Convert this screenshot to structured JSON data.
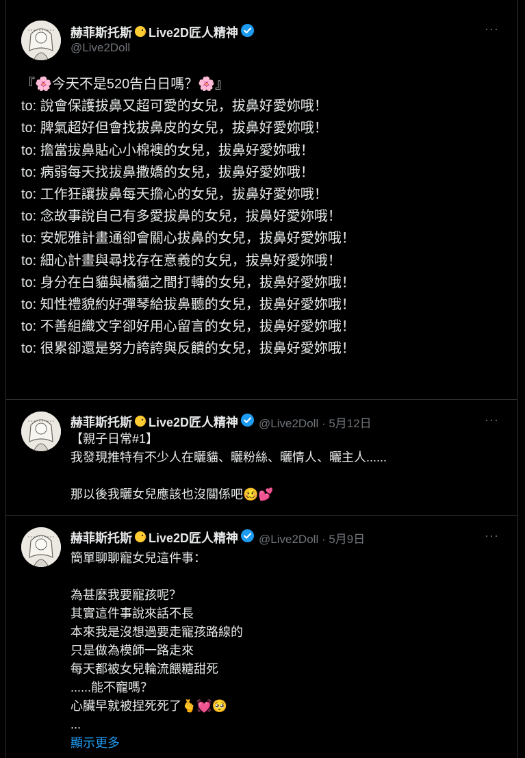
{
  "main_tweet": {
    "display_name": "赫菲斯托斯",
    "display_name_suffix": "Live2D匠人精神",
    "handle": "@Live2Doll",
    "lines": [
      "『🌸今天不是520告白日嗎？🌸』",
      "",
      "to: 說會保護拔鼻又超可愛的女兒，拔鼻好愛妳哦！",
      "to: 脾氣超好但會找拔鼻皮的女兒，拔鼻好愛妳哦！",
      "to: 擔當拔鼻貼心小棉襖的女兒，拔鼻好愛妳哦！",
      "to: 病弱每天找拔鼻撒嬌的女兒，拔鼻好愛妳哦！",
      "to: 工作狂讓拔鼻每天擔心的女兒，拔鼻好愛妳哦！",
      "to: 念故事說自己有多愛拔鼻的女兒，拔鼻好愛妳哦！",
      "to: 安妮雅計畫通卻會關心拔鼻的女兒，拔鼻好愛妳哦！",
      "to: 細心計畫與尋找存在意義的女兒，拔鼻好愛妳哦！",
      "to: 身分在白貓與橘貓之間打轉的女兒，拔鼻好愛妳哦！",
      "to: 知性禮貌約好彈琴給拔鼻聽的女兒，拔鼻好愛妳哦！",
      "to: 不善組織文字卻好用心留言的女兒，拔鼻好愛妳哦！",
      "to: 很累卻還是努力誇誇與反饋的女兒，拔鼻好愛妳哦！"
    ]
  },
  "reply1": {
    "display_name": "赫菲斯托斯",
    "display_name_suffix": "Live2D匠人精神",
    "handle_date": "@Live2Doll · 5月12日",
    "lines": [
      "【親子日常#1】",
      "我發現推特有不少人在曬貓、曬粉絲、曬情人、曬主人......",
      "",
      "那以後我曬女兒應該也沒關係吧🥴💕"
    ]
  },
  "reply2": {
    "display_name": "赫菲斯托斯",
    "display_name_suffix": "Live2D匠人精神",
    "handle_date": "@Live2Doll · 5月9日",
    "lines": [
      "簡單聊聊寵女兒這件事：",
      "",
      "為甚麼我要寵孩呢？",
      "其實這件事說來話不長",
      "本來我是沒想過要走寵孩路線的",
      "只是做為模師一路走來",
      "每天都被女兒輪流餵糖甜死",
      "......能不寵嗎？",
      "心臟早就被捏死死了🫰💓🥺",
      "..."
    ],
    "show_more": "顯示更多"
  },
  "more_label": "···"
}
